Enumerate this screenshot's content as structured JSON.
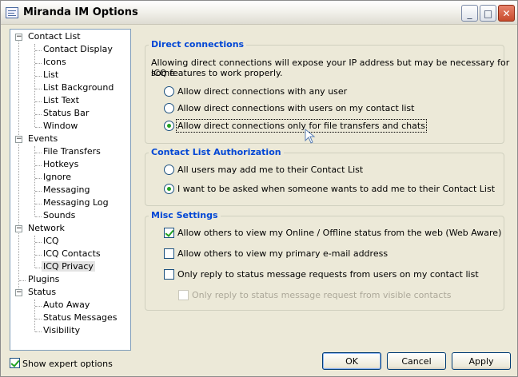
{
  "window": {
    "title": "Miranda IM Options"
  },
  "titlebar_buttons": {
    "minimize": "_",
    "maximize": "□",
    "close": "✕"
  },
  "tree": {
    "groups": [
      {
        "label": "Contact List",
        "expanded": true,
        "children": [
          "Contact Display",
          "Icons",
          "List",
          "List Background",
          "List Text",
          "Status Bar",
          "Window"
        ]
      },
      {
        "label": "Events",
        "expanded": true,
        "children": [
          "File Transfers",
          "Hotkeys",
          "Ignore",
          "Messaging",
          "Messaging Log",
          "Sounds"
        ]
      },
      {
        "label": "Network",
        "expanded": true,
        "children": [
          "ICQ",
          "ICQ Contacts",
          "ICQ Privacy"
        ]
      },
      {
        "label": "Plugins",
        "expanded": false,
        "children": []
      },
      {
        "label": "Status",
        "expanded": true,
        "children": [
          "Auto Away",
          "Status Messages",
          "Visibility"
        ]
      }
    ],
    "selected": "ICQ Privacy"
  },
  "direct_connections": {
    "title": "Direct connections",
    "description_line1": "Allowing direct connections will expose your IP address but may be necessary for some",
    "description_line2": "ICQ features to work properly.",
    "options": [
      {
        "label": "Allow direct connections with any user",
        "selected": false
      },
      {
        "label": "Allow direct connections with users on my contact list",
        "selected": false
      },
      {
        "label": "Allow direct connections only for file transfers and chats",
        "selected": true
      }
    ]
  },
  "authorization": {
    "title": "Contact List Authorization",
    "options": [
      {
        "label": "All users may add me to their Contact List",
        "selected": false
      },
      {
        "label": "I want to be asked when someone wants to add me to their Contact List",
        "selected": true
      }
    ]
  },
  "misc": {
    "title": "Misc Settings",
    "options": [
      {
        "label": "Allow others to view my Online / Offline status from the web (Web Aware)",
        "checked": true,
        "enabled": true
      },
      {
        "label": "Allow others to view my primary e-mail address",
        "checked": false,
        "enabled": true
      },
      {
        "label": "Only reply to status message requests from users on my contact list",
        "checked": false,
        "enabled": true
      },
      {
        "label": "Only reply to status message request from visible contacts",
        "checked": false,
        "enabled": false
      }
    ]
  },
  "footer": {
    "expert_label": "Show expert options",
    "expert_checked": true,
    "ok_label": "OK",
    "cancel_label": "Cancel",
    "apply_label": "Apply"
  },
  "colors": {
    "group_title": "#0046d5",
    "window_bg": "#ece9d8",
    "check": "#21a121"
  }
}
